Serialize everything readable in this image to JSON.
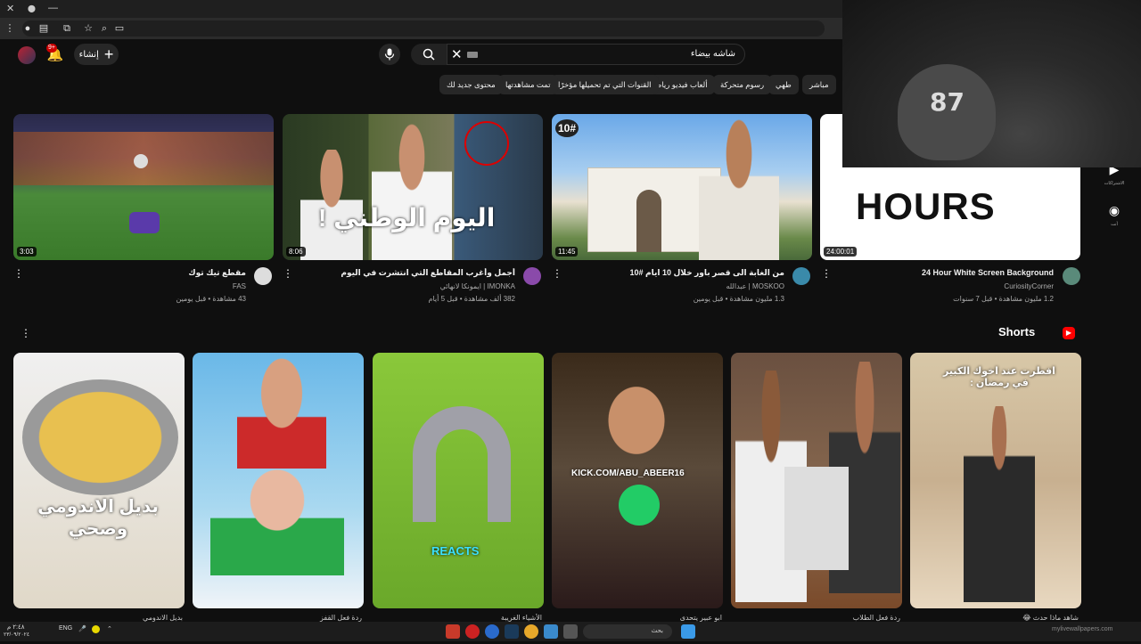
{
  "browser": {
    "window_controls": [
      "✕",
      "⬤",
      "—"
    ],
    "tab_icons": [
      "menu-icon",
      "record-icon",
      "cast-icon",
      "extension-icon",
      "star-icon",
      "search-icon",
      "screen-icon"
    ]
  },
  "header": {
    "notification_count": "9+",
    "create_label": "إنشاء",
    "search_value": "شاشه بيضاء"
  },
  "chips": [
    "مباشر",
    "طهي",
    "رسوم متحركة",
    "ألعاب فيديو رياضية",
    "القنوات التي تم تحميلها مؤخرًا",
    "تمت مشاهدتها",
    "محتوى جديد لك"
  ],
  "rail": {
    "subscriptions_label": "الاشتراكات",
    "you_label": "أنت"
  },
  "webcam": {
    "cap_text": "87"
  },
  "videos": [
    {
      "duration": "24:00:01",
      "thumb_text": "HOURS",
      "title": "24 Hour White Screen Background",
      "channel": "CuriosityCorner",
      "meta": "1.2 مليون مشاهدة • قبل 7 سنوات"
    },
    {
      "duration": "11:45",
      "thumb_badge": "10#",
      "title": "من الغابة الى قصر باور خلال 10 ايام #10",
      "channel": "MOSKOO | عبدالله",
      "meta": "1.3 مليون مشاهدة • قبل يومين"
    },
    {
      "duration": "8:06",
      "thumb_text": "اليوم الوطني !",
      "title": "أجمل وأغرب المقاطع التي انتشرت في اليوم الوطني!!",
      "channel": "IMONKA | ايمونكا لانهائي",
      "meta": "382 ألف مشاهدة • قبل 5 أيام"
    },
    {
      "duration": "3:03",
      "title": "مقطع تيك توك",
      "channel": "FAS",
      "meta": "43 مشاهدة • قبل يومين"
    }
  ],
  "shorts": {
    "heading": "Shorts",
    "items": [
      {
        "caption": "افطرت عند اخوك الكبير في رمضان :",
        "title": "شاهد ماذا حدث 😂"
      },
      {
        "caption": "",
        "title": "ردة فعل الطلاب"
      },
      {
        "caption": "KICK.COM/ABU_ABEER16",
        "title": "ابو عبير يتحدى"
      },
      {
        "caption": "REACTS",
        "title": "الأشياء الغريبة"
      },
      {
        "caption": "",
        "title": "ردة فعل القفز"
      },
      {
        "caption": "بديل الاندومي وصحي",
        "title": "بديل الاندومي"
      }
    ]
  },
  "taskbar": {
    "search_label": "بحث",
    "lang": "ENG",
    "time": "٢:٤٨ م",
    "date": "٢٣/٠٩/٢٠٢٤",
    "watermark": "mylivewallpapers.com"
  }
}
